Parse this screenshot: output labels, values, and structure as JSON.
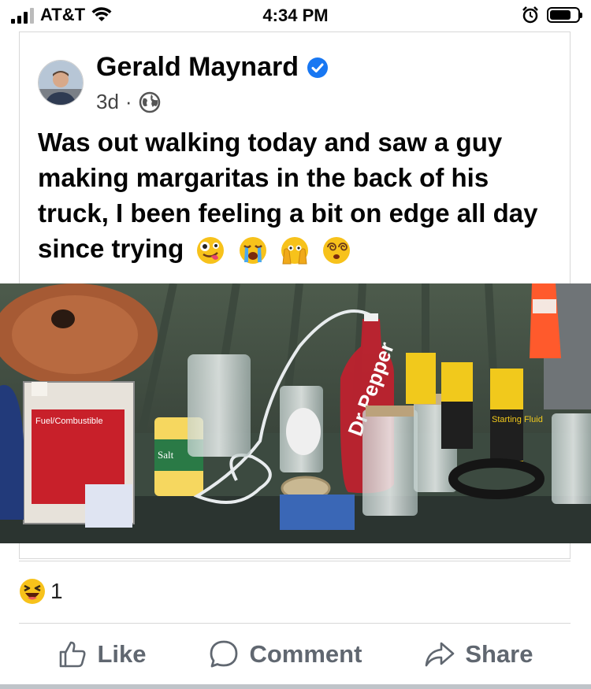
{
  "status_bar": {
    "carrier": "AT&T",
    "time": "4:34 PM",
    "battery_level": 0.75
  },
  "post": {
    "author": "Gerald Maynard",
    "verified": true,
    "age": "3d",
    "separator": "·",
    "audience_icon": "globe-icon",
    "text": "Was out walking today and saw a guy making margaritas in the back of his truck, I been feeling a bit on edge all day since trying",
    "emojis": [
      "zany-face-icon",
      "crying-face-icon",
      "face-with-hands-icon",
      "dizzy-face-icon"
    ],
    "photo_labels": {
      "fuel_can": "Fuel/Combustible",
      "salt": "Salt",
      "soda": "Dr Pepper",
      "starting_fluid": "Starting Fluid"
    }
  },
  "reactions": {
    "icon": "laughing-emoji-icon",
    "count": "1"
  },
  "actions": {
    "like": "Like",
    "comment": "Comment",
    "share": "Share"
  },
  "colors": {
    "verified_blue": "#1877f2",
    "action_gray": "#606770"
  }
}
